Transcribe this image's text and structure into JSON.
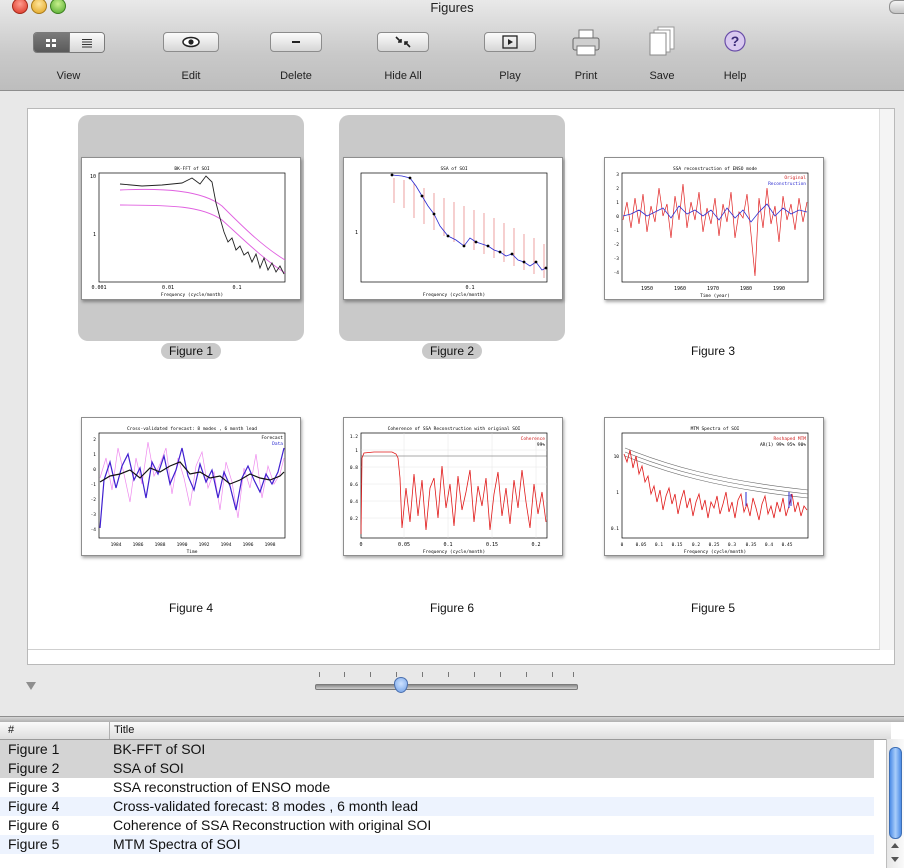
{
  "window": {
    "title": "Figures"
  },
  "toolbar": {
    "view_label": "View",
    "edit_label": "Edit",
    "delete_label": "Delete",
    "hideall_label": "Hide All",
    "play_label": "Play",
    "print_label": "Print",
    "save_label": "Save",
    "help_label": "Help"
  },
  "figures": [
    {
      "caption": "Figure 1",
      "title": "BK-FFT of SOI",
      "xlabel": "Frequency (cycle/month)",
      "ticks_x": [
        "0.001",
        "0.01",
        "0.1"
      ],
      "ticks_y": [
        "10",
        "1"
      ],
      "selected": true
    },
    {
      "caption": "Figure 2",
      "title": "SSA of SOI",
      "xlabel": "Frequency (cycle/month)",
      "ticks_x": [
        "0.1"
      ],
      "ticks_y": [
        "1"
      ],
      "selected": true
    },
    {
      "caption": "Figure 3",
      "title": "SSA reconstruction of ENSO mode",
      "xlabel": "Time (year)",
      "legend": [
        "Original",
        "Reconstruction"
      ],
      "ticks_x": [
        "1950",
        "1960",
        "1970",
        "1980",
        "1990"
      ],
      "ticks_y": [
        "3",
        "2",
        "1",
        "0",
        "-1",
        "-2",
        "-3",
        "-4"
      ],
      "selected": false
    },
    {
      "caption": "Figure 4",
      "title": "Cross-validated forecast: 8 modes , 6 month lead",
      "xlabel": "Time",
      "legend": [
        "Forecast",
        "Data"
      ],
      "ticks_x": [
        "1984",
        "1986",
        "1988",
        "1990",
        "1992",
        "1994",
        "1996",
        "1998"
      ],
      "ticks_y": [
        "2",
        "1",
        "0",
        "-1",
        "-2",
        "-3",
        "-4"
      ],
      "selected": false
    },
    {
      "caption": "Figure 6",
      "title": "Coherence of SSA Reconstruction with original SOI",
      "xlabel": "Frequency (cycle/month)",
      "legend": [
        "Coherence",
        "99%"
      ],
      "ticks_x": [
        "0",
        "0.05",
        "0.1",
        "0.15",
        "0.2"
      ],
      "ticks_y": [
        "1.2",
        "1",
        "0.8",
        "0.6",
        "0.4",
        "0.2"
      ],
      "selected": false
    },
    {
      "caption": "Figure 5",
      "title": "MTM Spectra of SOI",
      "xlabel": "Frequency (cycle/month)",
      "legend": [
        "Reshaped MTM",
        "AR(1) 99% 95% 90%"
      ],
      "ticks_x": [
        "0",
        "0.05",
        "0.1",
        "0.15",
        "0.2",
        "0.25",
        "0.3",
        "0.35",
        "0.4",
        "0.45"
      ],
      "ticks_y": [
        "10",
        "1",
        "0.1"
      ],
      "selected": false
    }
  ],
  "table": {
    "headers": [
      "#",
      "Title"
    ],
    "rows": [
      {
        "num": "Figure 1",
        "title": "BK-FFT of SOI"
      },
      {
        "num": "Figure 2",
        "title": "SSA of SOI"
      },
      {
        "num": "Figure 3",
        "title": "SSA reconstruction of ENSO mode"
      },
      {
        "num": "Figure 4",
        "title": "Cross-validated forecast: 8 modes , 6 month lead"
      },
      {
        "num": "Figure 6",
        "title": "Coherence of SSA Reconstruction with original SOI"
      },
      {
        "num": "Figure 5",
        "title": "MTM Spectra of SOI"
      }
    ]
  },
  "colors": {
    "selection": "#c9c9c9",
    "row_selected": "#d4d4d4",
    "row_alt": "#edf3fe",
    "accent": "#4e8de6"
  }
}
